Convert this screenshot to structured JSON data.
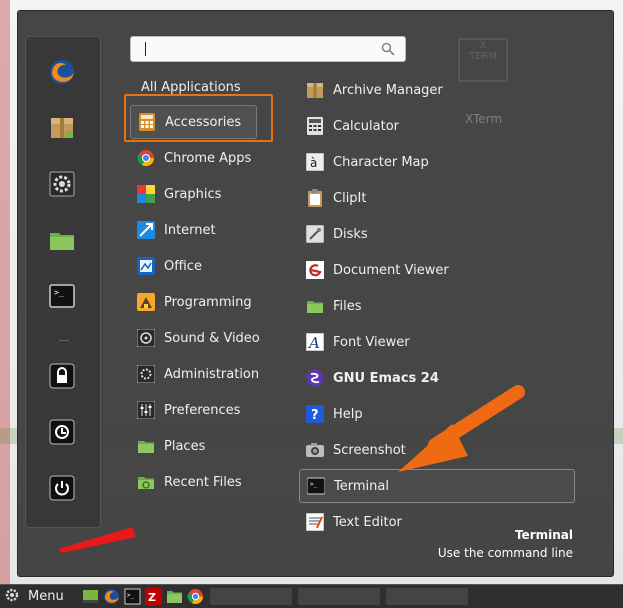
{
  "search": {
    "placeholder": "",
    "value": ""
  },
  "all_applications_label": "All Applications",
  "categories": [
    {
      "label": "Accessories",
      "icon": "accessories-icon",
      "selected": true
    },
    {
      "label": "Chrome Apps",
      "icon": "chrome-icon"
    },
    {
      "label": "Graphics",
      "icon": "graphics-icon"
    },
    {
      "label": "Internet",
      "icon": "internet-icon"
    },
    {
      "label": "Office",
      "icon": "office-icon"
    },
    {
      "label": "Programming",
      "icon": "programming-icon"
    },
    {
      "label": "Sound & Video",
      "icon": "sound-video-icon"
    },
    {
      "label": "Administration",
      "icon": "administration-icon"
    },
    {
      "label": "Preferences",
      "icon": "preferences-icon"
    },
    {
      "label": "Places",
      "icon": "folder-icon"
    },
    {
      "label": "Recent Files",
      "icon": "recent-files-icon"
    }
  ],
  "apps": [
    {
      "label": "Archive Manager",
      "icon": "archive-icon"
    },
    {
      "label": "Calculator",
      "icon": "calculator-icon"
    },
    {
      "label": "Character Map",
      "icon": "character-map-icon"
    },
    {
      "label": "ClipIt",
      "icon": "clipboard-icon"
    },
    {
      "label": "Disks",
      "icon": "disks-icon"
    },
    {
      "label": "Document Viewer",
      "icon": "document-viewer-icon"
    },
    {
      "label": "Files",
      "icon": "folder-icon"
    },
    {
      "label": "Font Viewer",
      "icon": "font-viewer-icon"
    },
    {
      "label": "GNU Emacs 24",
      "icon": "emacs-icon",
      "bold": true
    },
    {
      "label": "Help",
      "icon": "help-icon"
    },
    {
      "label": "Screenshot",
      "icon": "camera-icon"
    },
    {
      "label": "Terminal",
      "icon": "terminal-icon",
      "selected": true
    },
    {
      "label": "Text Editor",
      "icon": "text-editor-icon"
    }
  ],
  "description": {
    "title": "Terminal",
    "text": "Use the command line"
  },
  "favorites": [
    "firefox-icon",
    "package-icon",
    "settings-icon",
    "folder-icon",
    "terminal-icon",
    "lock-icon",
    "logout-icon",
    "power-icon"
  ],
  "background_app": {
    "label": "XTerm",
    "icon_text": "X\nTERM"
  },
  "taskbar": {
    "menu_label": "Menu",
    "window_label": ""
  },
  "colors": {
    "highlight_orange": "#e8720c",
    "menu_bg": "#3e3e3e",
    "arrow": "#f06a14"
  }
}
